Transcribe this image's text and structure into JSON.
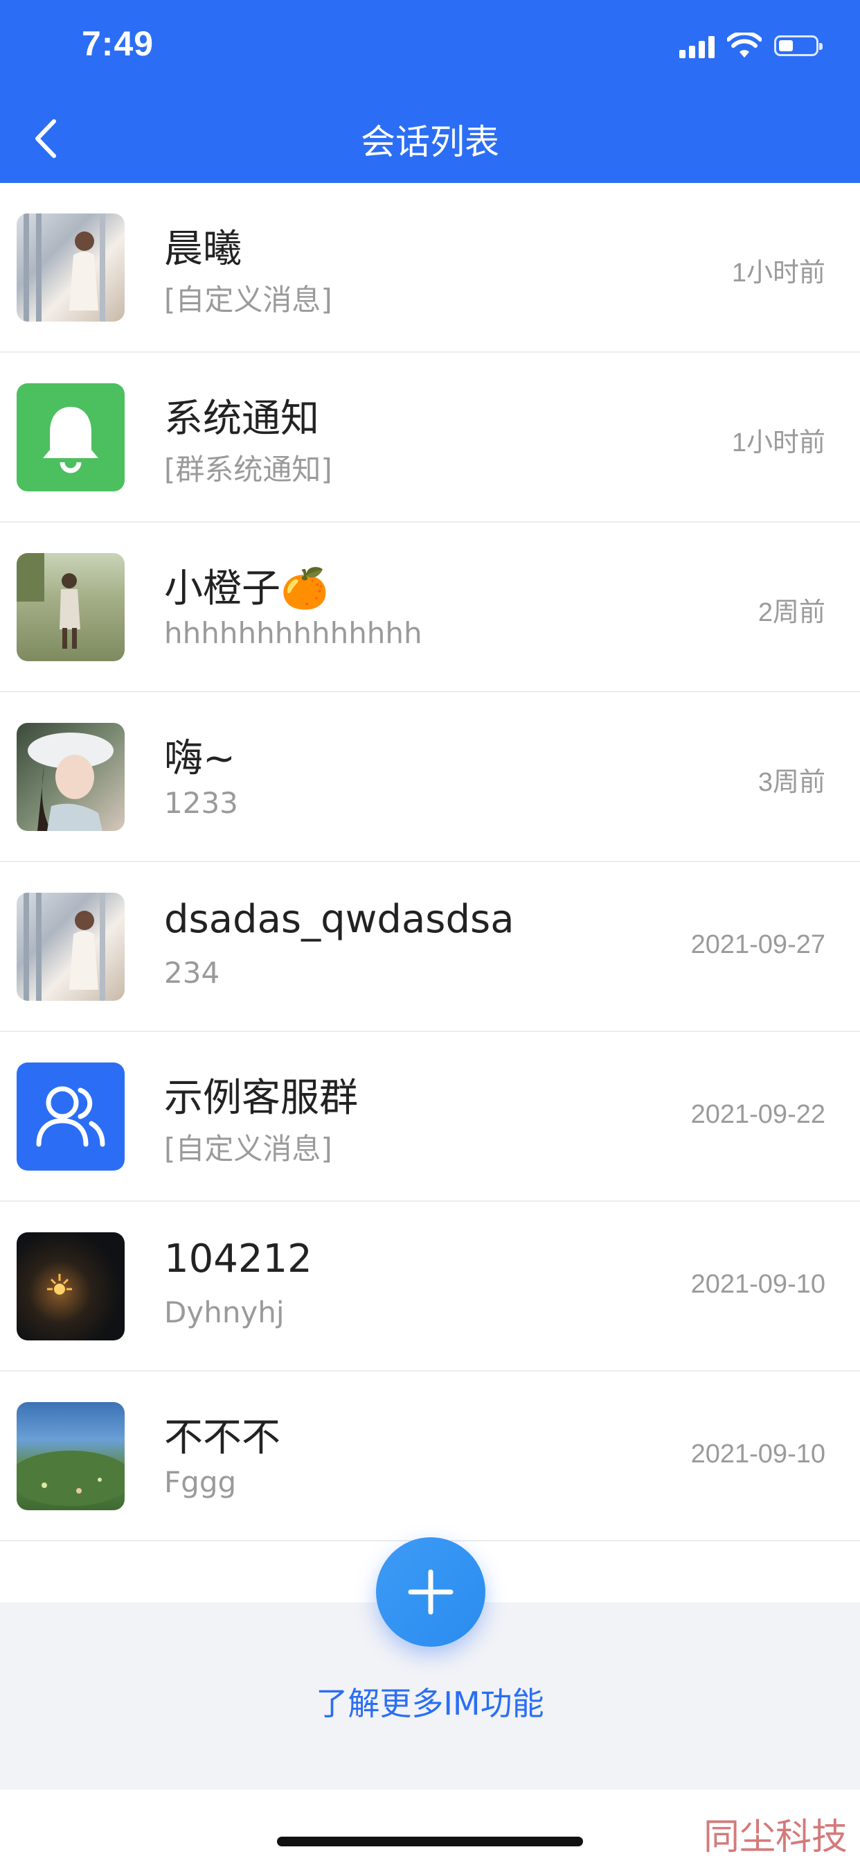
{
  "status_bar": {
    "time": "7:49"
  },
  "nav": {
    "title": "会话列表"
  },
  "conversations": [
    {
      "name": "晨曦",
      "message": "[自定义消息]",
      "time": "1小时前",
      "avatar": "photo-avatar"
    },
    {
      "name": "系统通知",
      "message": "[群系统通知]",
      "time": "1小时前",
      "avatar": "bell-icon"
    },
    {
      "name": "小橙子🍊",
      "message": "hhhhhhhhhhhhhh",
      "time": "2周前",
      "avatar": "photo-avatar"
    },
    {
      "name": "嗨~",
      "message": "1233",
      "time": "3周前",
      "avatar": "photo-avatar"
    },
    {
      "name": "dsadas_qwdasdsa",
      "message": "234",
      "time": "2021-09-27",
      "avatar": "photo-avatar"
    },
    {
      "name": "示例客服群",
      "message": "[自定义消息]",
      "time": "2021-09-22",
      "avatar": "group-icon"
    },
    {
      "name": "104212",
      "message": "Dyhnyhj",
      "time": "2021-09-10",
      "avatar": "photo-avatar"
    },
    {
      "name": "不不不",
      "message": "Fggg",
      "time": "2021-09-10",
      "avatar": "photo-avatar"
    }
  ],
  "bottom": {
    "learn_more": "了解更多IM功能"
  },
  "watermark": "同尘科技",
  "colors": {
    "brand": "#2b6ef5",
    "bell_bg": "#4cbf5f",
    "group_bg": "#2b6ef5"
  }
}
